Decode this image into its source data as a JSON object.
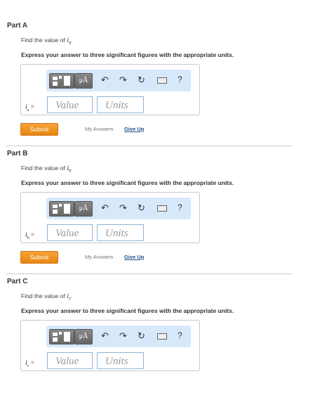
{
  "parts": [
    {
      "title": "Part A",
      "find_prefix": "Find the value of ",
      "var_letter": "i",
      "var_sub": "a",
      "find_suffix": ".",
      "express": "Express your answer to three significant figures with the appropriate units.",
      "value_placeholder": "Value",
      "units_placeholder": "Units",
      "submit_label": "Submit",
      "my_answers_label": "My Answers",
      "give_up_label": "Give Up"
    },
    {
      "title": "Part B",
      "find_prefix": "Find the value of ",
      "var_letter": "i",
      "var_sub": "b",
      "find_suffix": ".",
      "express": "Express your answer to three significant figures with the appropriate units.",
      "value_placeholder": "Value",
      "units_placeholder": "Units",
      "submit_label": "Submit",
      "my_answers_label": "My Answers",
      "give_up_label": "Give Up"
    },
    {
      "title": "Part C",
      "find_prefix": "Find the value of ",
      "var_letter": "i",
      "var_sub": "c",
      "find_suffix": ".",
      "express": "Express your answer to three significant figures with the appropriate units.",
      "value_placeholder": "Value",
      "units_placeholder": "Units"
    }
  ],
  "toolbar": {
    "units_button_label": "μÅ",
    "help_label": "?",
    "icons": [
      "templates-icon",
      "units-icon",
      "undo-icon",
      "redo-icon",
      "reset-icon",
      "keyboard-icon",
      "help-icon"
    ]
  },
  "equals": "=",
  "colors": {
    "submit": "#ef8f1f",
    "toolbar_bg": "#d7e8fb",
    "input_border": "#8fb4d8",
    "link": "#1f4e8c"
  }
}
